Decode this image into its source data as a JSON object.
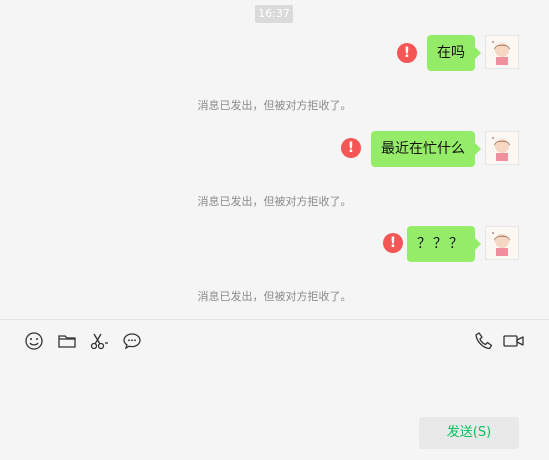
{
  "chat": {
    "timestamp": "16:37",
    "messages": [
      {
        "text": "在吗",
        "status": "!"
      },
      {
        "text": "最近在忙什么",
        "status": "!"
      },
      {
        "text": "？？？",
        "status": "!"
      }
    ],
    "notices": [
      "消息已发出，但被对方拒收了。",
      "消息已发出，但被对方拒收了。",
      "消息已发出，但被对方拒收了。"
    ]
  },
  "toolbar": {
    "icons": [
      "emoji-icon",
      "folder-icon",
      "scissors-icon",
      "chat-bubble-icon",
      "phone-icon",
      "video-icon"
    ]
  },
  "composer": {
    "value": ""
  },
  "send_button": {
    "label": "发送(S)"
  },
  "colors": {
    "bubble": "#95ec69",
    "error": "#f35654",
    "send_text": "#07c160",
    "background": "#f5f5f5"
  }
}
